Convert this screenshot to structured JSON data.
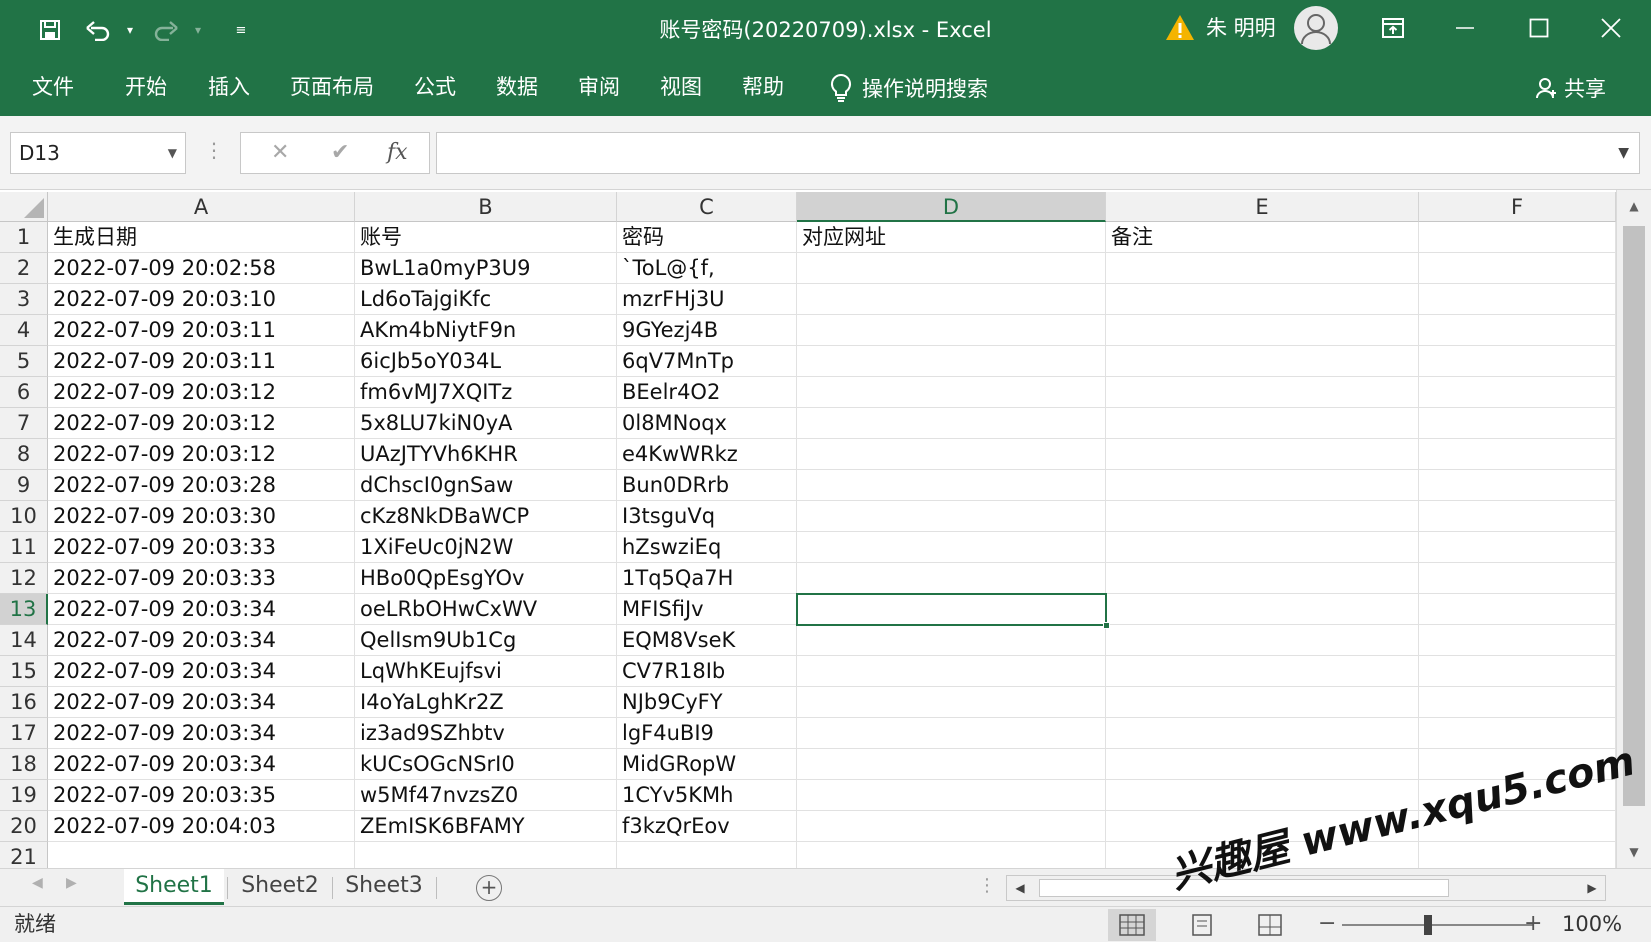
{
  "window": {
    "title": "账号密码(20220709).xlsx  -  Excel",
    "user_name": "朱 明明"
  },
  "ribbon": {
    "tabs": [
      "文件",
      "开始",
      "插入",
      "页面布局",
      "公式",
      "数据",
      "审阅",
      "视图",
      "帮助"
    ],
    "search_label": "操作说明搜索",
    "share_label": "共享"
  },
  "formula_bar": {
    "name_box": "D13",
    "formula": ""
  },
  "sheet": {
    "columns": [
      "A",
      "B",
      "C",
      "D",
      "E",
      "F"
    ],
    "active_column": "D",
    "active_row": 13,
    "row_numbers": [
      1,
      2,
      3,
      4,
      5,
      6,
      7,
      8,
      9,
      10,
      11,
      12,
      13,
      14,
      15,
      16,
      17,
      18,
      19,
      20,
      21
    ],
    "rows": [
      [
        "生成日期",
        "账号",
        "密码",
        "对应网址",
        "备注"
      ],
      [
        "2022-07-09 20:02:58",
        "BwL1a0myP3U9",
        "`ToL@{f,",
        "",
        ""
      ],
      [
        "2022-07-09 20:03:10",
        "Ld6oTajgiKfc",
        "mzrFHj3U",
        "",
        ""
      ],
      [
        "2022-07-09 20:03:11",
        "AKm4bNiytF9n",
        "9GYezj4B",
        "",
        ""
      ],
      [
        "2022-07-09 20:03:11",
        "6icJb5oY034L",
        "6qV7MnTp",
        "",
        ""
      ],
      [
        "2022-07-09 20:03:12",
        "fm6vMJ7XQITz",
        "BEelr4O2",
        "",
        ""
      ],
      [
        "2022-07-09 20:03:12",
        "5x8LU7kiN0yA",
        "0l8MNoqx",
        "",
        ""
      ],
      [
        "2022-07-09 20:03:12",
        "UAzJTYVh6KHR",
        "e4KwWRkz",
        "",
        ""
      ],
      [
        "2022-07-09 20:03:28",
        "dChscI0gnSaw",
        "Bun0DRrb",
        "",
        ""
      ],
      [
        "2022-07-09 20:03:30",
        "cKz8NkDBaWCP",
        "I3tsguVq",
        "",
        ""
      ],
      [
        "2022-07-09 20:03:33",
        "1XiFeUc0jN2W",
        "hZswziEq",
        "",
        ""
      ],
      [
        "2022-07-09 20:03:33",
        "HBo0QpEsgYOv",
        "1Tq5Qa7H",
        "",
        ""
      ],
      [
        "2022-07-09 20:03:34",
        "oeLRbOHwCxWV",
        "MFISfiJv",
        "",
        ""
      ],
      [
        "2022-07-09 20:03:34",
        "QelIsm9Ub1Cg",
        "EQM8VseK",
        "",
        ""
      ],
      [
        "2022-07-09 20:03:34",
        "LqWhKEujfsvi",
        "CV7R18Ib",
        "",
        ""
      ],
      [
        "2022-07-09 20:03:34",
        "I4oYaLghKr2Z",
        "NJb9CyFY",
        "",
        ""
      ],
      [
        "2022-07-09 20:03:34",
        "iz3ad9SZhbtv",
        "lgF4uBI9",
        "",
        ""
      ],
      [
        "2022-07-09 20:03:34",
        "kUCsOGcNSrI0",
        "MidGRopW",
        "",
        ""
      ],
      [
        "2022-07-09 20:03:35",
        "w5Mf47nvzsZ0",
        "1CYv5KMh",
        "",
        ""
      ],
      [
        "2022-07-09 20:04:03",
        "ZEmISK6BFAMY",
        "f3kzQrEov",
        "",
        ""
      ],
      [
        "",
        "",
        "",
        "",
        ""
      ]
    ]
  },
  "sheet_tabs": [
    "Sheet1",
    "Sheet2",
    "Sheet3"
  ],
  "active_sheet": "Sheet1",
  "status": {
    "text": "就绪",
    "zoom": "100%"
  },
  "watermark": "兴趣屋 www.xqu5.com",
  "colors": {
    "accent": "#217346"
  }
}
